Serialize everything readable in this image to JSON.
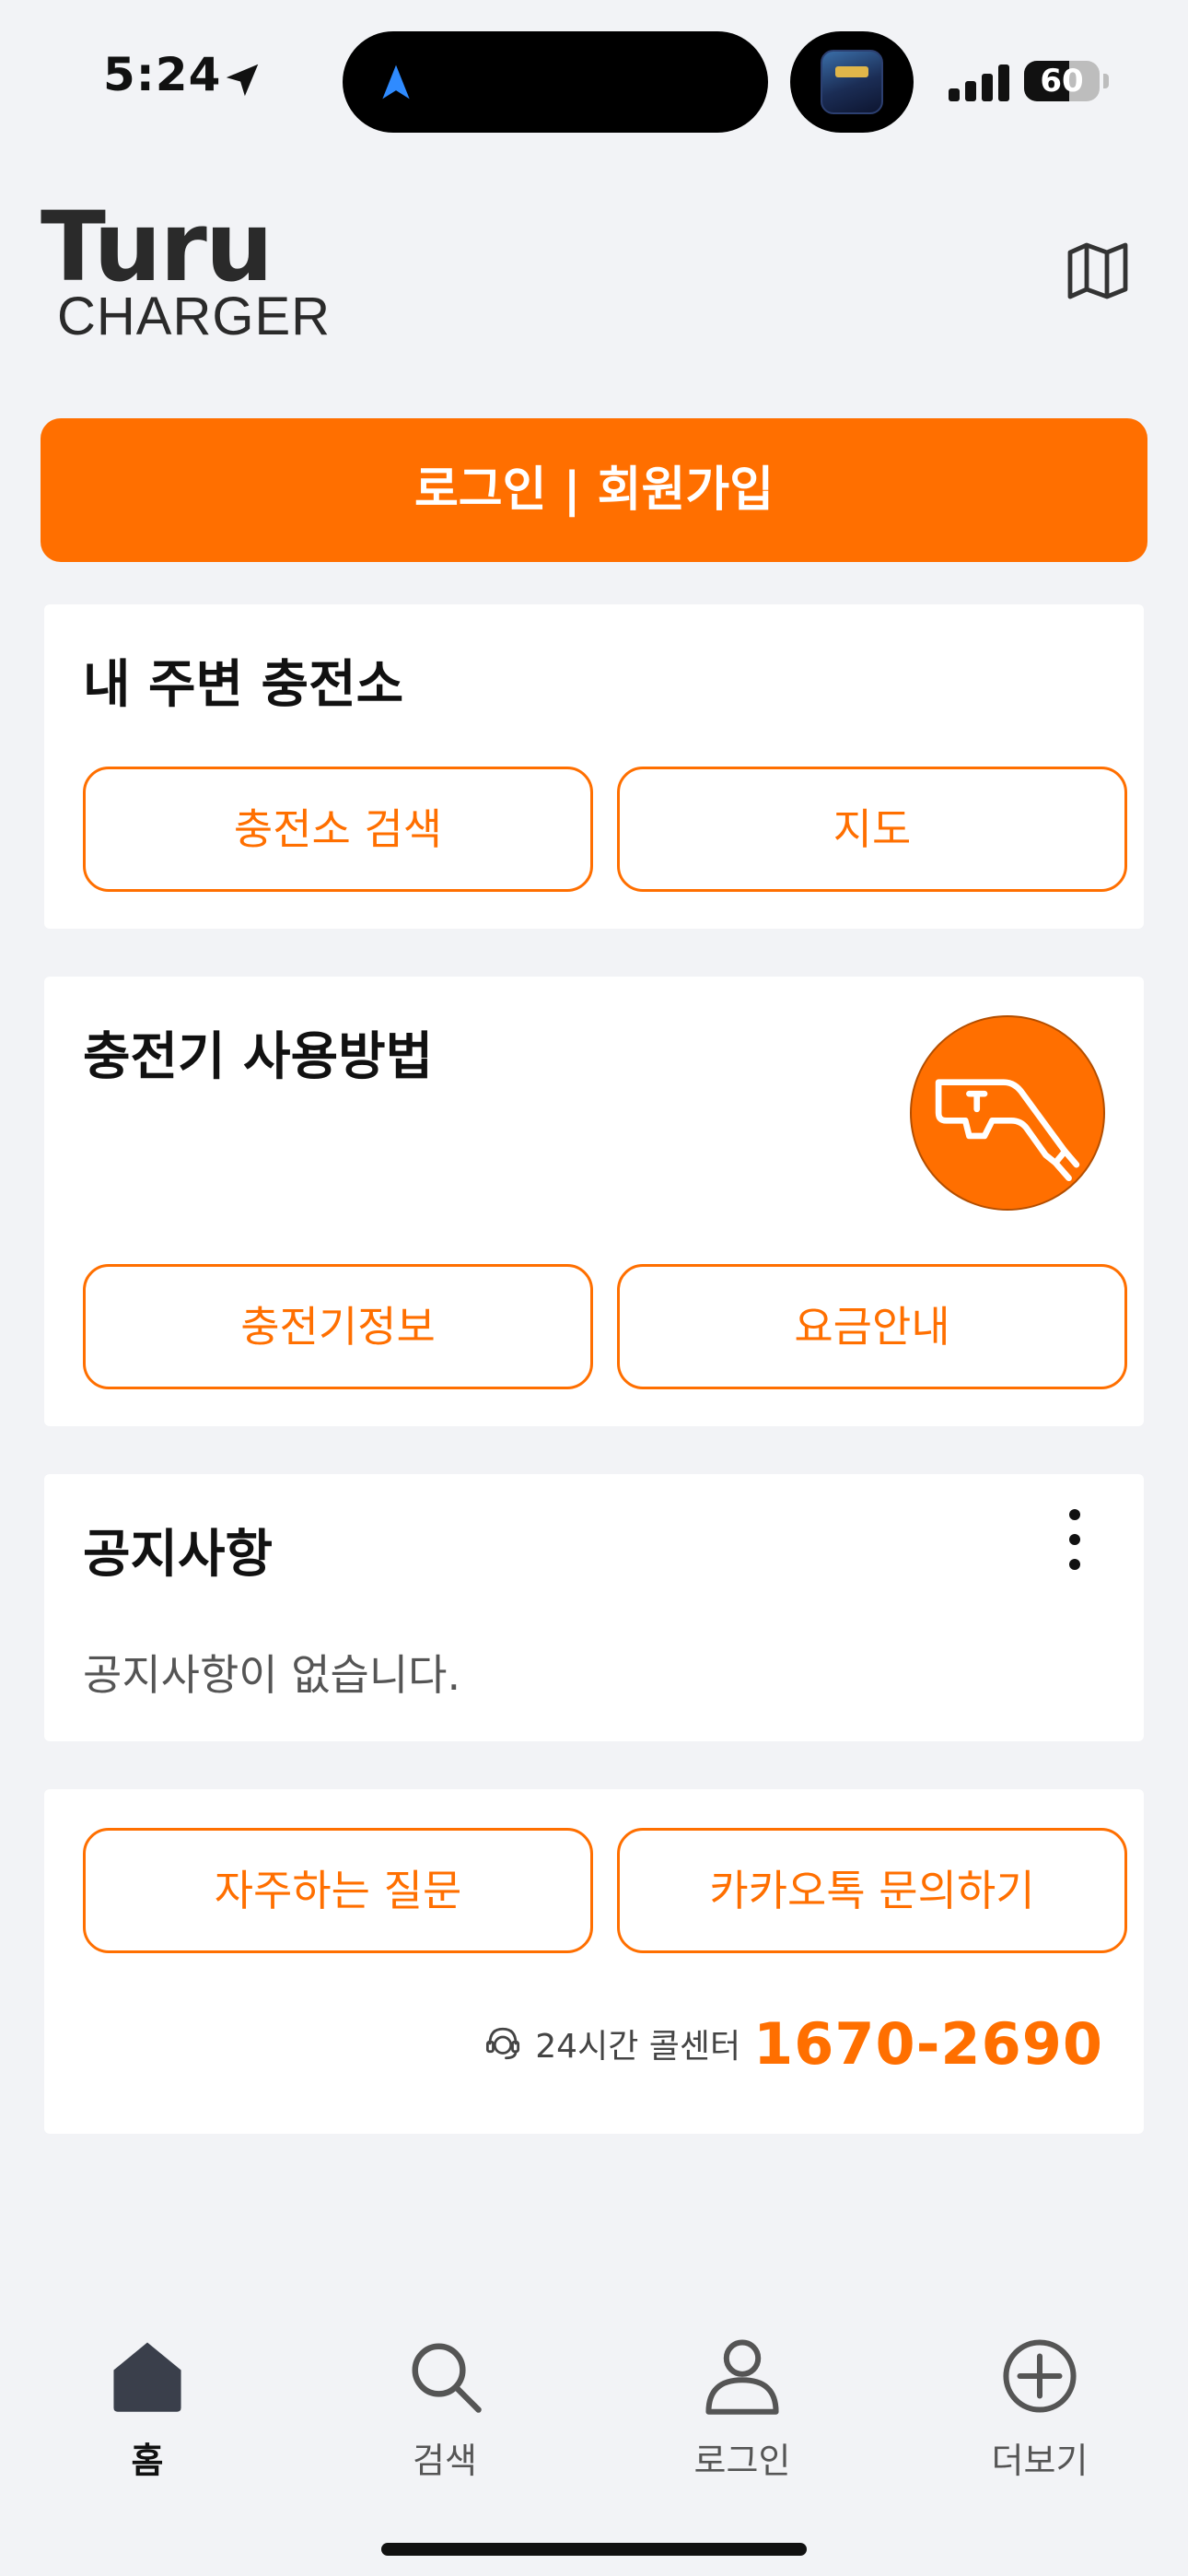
{
  "status_bar": {
    "time": "5:24",
    "battery_level": "60",
    "battery_fraction": 0.6
  },
  "header": {
    "logo_word": "Turu",
    "logo_sub": "CHARGER",
    "map_icon": "map-icon"
  },
  "login_button": "로그인 | 회원가입",
  "nearby": {
    "title": "내 주변 충전소",
    "search_button": "충전소 검색",
    "map_button": "지도"
  },
  "usage": {
    "title": "충전기 사용방법",
    "info_button": "충전기정보",
    "price_button": "요금안내",
    "illustration_icon": "ev-plug-icon"
  },
  "notice": {
    "title": "공지사항",
    "empty_text": "공지사항이 없습니다.",
    "menu_icon": "more-vertical-icon"
  },
  "help": {
    "faq_button": "자주하는 질문",
    "kakao_button": "카카오톡 문의하기",
    "callcenter_label": "24시간 콜센터",
    "callcenter_phone": "1670-2690",
    "headset_icon": "headset-icon"
  },
  "tabs": [
    {
      "label": "홈",
      "icon": "home-icon",
      "active": true
    },
    {
      "label": "검색",
      "icon": "search-icon",
      "active": false
    },
    {
      "label": "로그인",
      "icon": "user-icon",
      "active": false
    },
    {
      "label": "더보기",
      "icon": "plus-circle-icon",
      "active": false
    }
  ],
  "colors": {
    "accent": "#ff6f00",
    "background": "#f2f3f6",
    "card": "#ffffff"
  }
}
